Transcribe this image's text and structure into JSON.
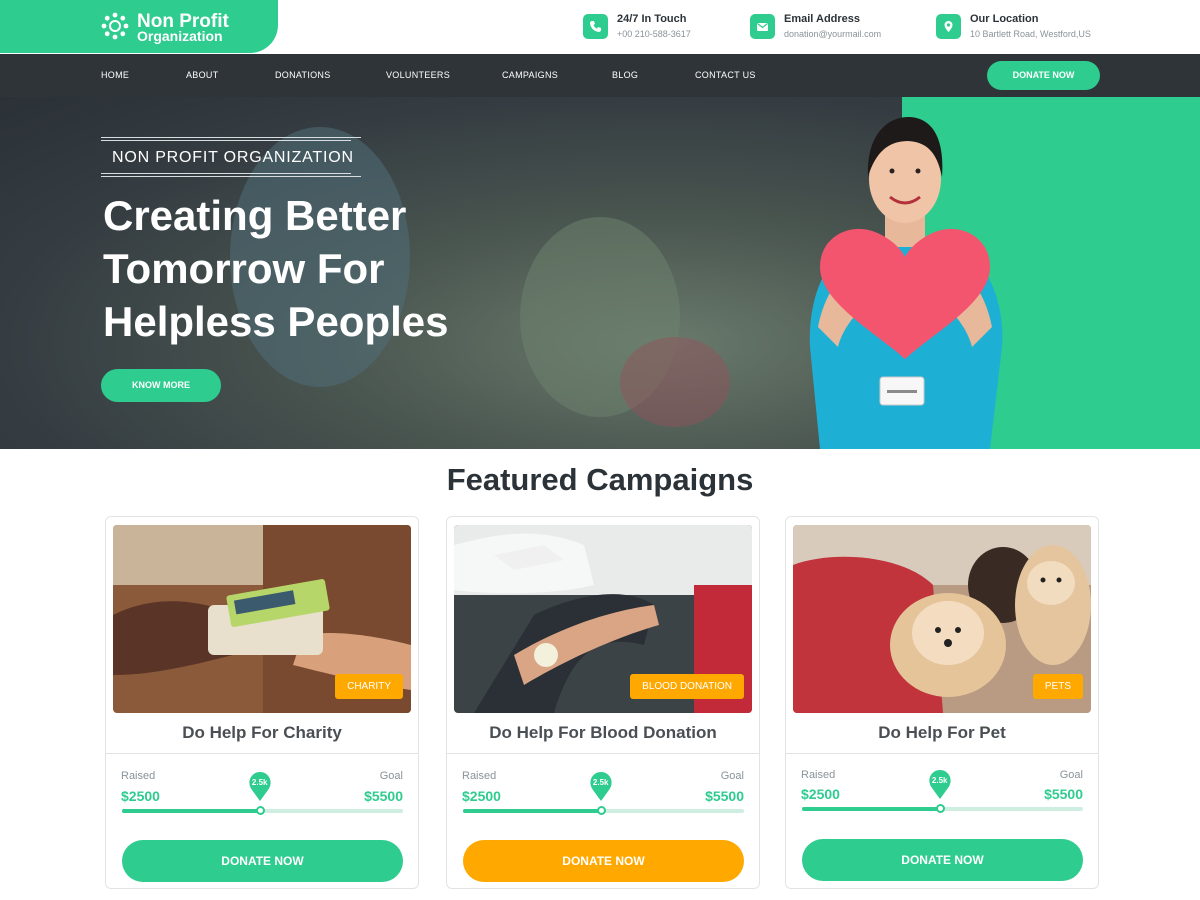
{
  "brand": {
    "name_line1": "Non Profit",
    "name_line2": "Organization",
    "accent_color": "#2ecc8f",
    "secondary_color": "#ffa800",
    "icon": "flower-logo-icon"
  },
  "contacts": [
    {
      "icon": "phone-icon",
      "title": "24/7 In Touch",
      "value": "+00 210-588-3617"
    },
    {
      "icon": "mail-icon",
      "title": "Email Address",
      "value": "donation@yourmail.com"
    },
    {
      "icon": "location-pin-icon",
      "title": "Our Location",
      "value": "10 Bartlett Road, Westford,US"
    }
  ],
  "nav": {
    "items": [
      "HOME",
      "ABOUT",
      "DONATIONS",
      "VOLUNTEERS",
      "CAMPAIGNS",
      "BLOG",
      "CONTACT US"
    ],
    "donate_label": "DONATE NOW"
  },
  "hero": {
    "tagline": "NON PROFIT ORGANIZATION",
    "heading_line1": "Creating Better",
    "heading_line2": "Tomorrow For",
    "heading_line3": "Helpless Peoples",
    "button_label": "KNOW MORE"
  },
  "featured": {
    "title": "Featured Campaigns",
    "raised_label": "Raised",
    "goal_label": "Goal",
    "cards": [
      {
        "tag": "CHARITY",
        "title": "Do Help For Charity",
        "raised": "$2500",
        "goal": "$5500",
        "marker": "2.5k",
        "progress": 0.49,
        "button": "DONATE NOW",
        "button_color": "#2ecc8f"
      },
      {
        "tag": "BLOOD DONATION",
        "title": "Do Help For Blood Donation",
        "raised": "$2500",
        "goal": "$5500",
        "marker": "2.5k",
        "progress": 0.49,
        "button": "DONATE NOW",
        "button_color": "#ffa800"
      },
      {
        "tag": "PETS",
        "title": "Do Help For Pet",
        "raised": "$2500",
        "goal": "$5500",
        "marker": "2.5k",
        "progress": 0.49,
        "button": "DONATE NOW",
        "button_color": "#2ecc8f"
      }
    ]
  }
}
